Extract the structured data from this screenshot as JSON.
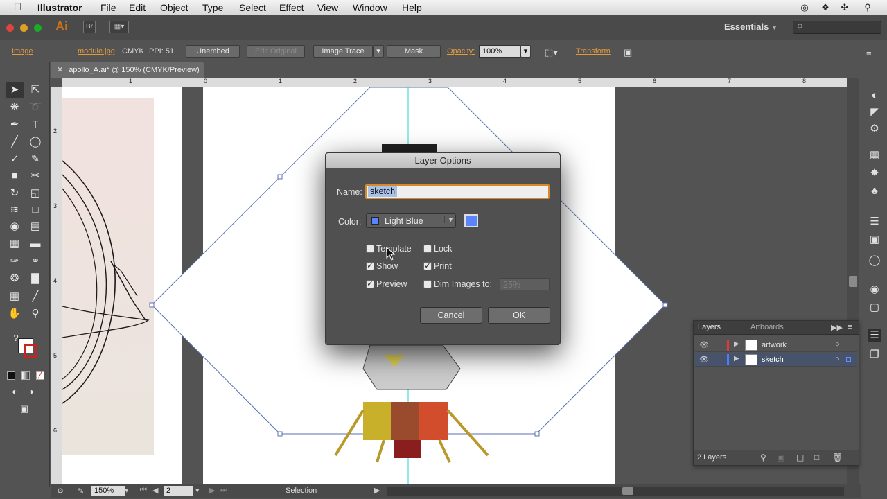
{
  "menubar": {
    "app": "Illustrator",
    "items": [
      "File",
      "Edit",
      "Object",
      "Type",
      "Select",
      "Effect",
      "View",
      "Window",
      "Help"
    ]
  },
  "appbar": {
    "logo": "Ai",
    "bridge": "Br",
    "workspace": "Essentials"
  },
  "control": {
    "type_label": "Image",
    "filename": "module.jpg",
    "colormode": "CMYK",
    "ppi": "PPI: 51",
    "unembed": "Unembed",
    "edit_original": "Edit Original",
    "image_trace": "Image Trace",
    "mask": "Mask",
    "opacity_label": "Opacity:",
    "opacity_value": "100%",
    "transform": "Transform"
  },
  "document": {
    "tab_title": "apollo_A.ai* @ 150% (CMYK/Preview)",
    "ruler_top": [
      "1",
      "0",
      "1",
      "2",
      "3",
      "4",
      "5",
      "6",
      "7",
      "8"
    ],
    "ruler_left": [
      "2",
      "3",
      "4",
      "5",
      "6"
    ]
  },
  "status": {
    "zoom": "150%",
    "artboard": "2",
    "tool": "Selection"
  },
  "layers_panel": {
    "tab_layers": "Layers",
    "tab_artboards": "Artboards",
    "rows": [
      {
        "name": "artwork",
        "color": "#e0393e"
      },
      {
        "name": "sketch",
        "color": "#4f7cff"
      }
    ],
    "count": "2 Layers"
  },
  "dialog": {
    "title": "Layer Options",
    "name_label": "Name:",
    "name_value": "sketch",
    "color_label": "Color:",
    "color_value": "Light Blue",
    "swatch": "#5b84ff",
    "template": "Template",
    "lock": "Lock",
    "show": "Show",
    "print": "Print",
    "preview": "Preview",
    "dim_images": "Dim Images to:",
    "dim_value": "25%",
    "cancel": "Cancel",
    "ok": "OK"
  }
}
